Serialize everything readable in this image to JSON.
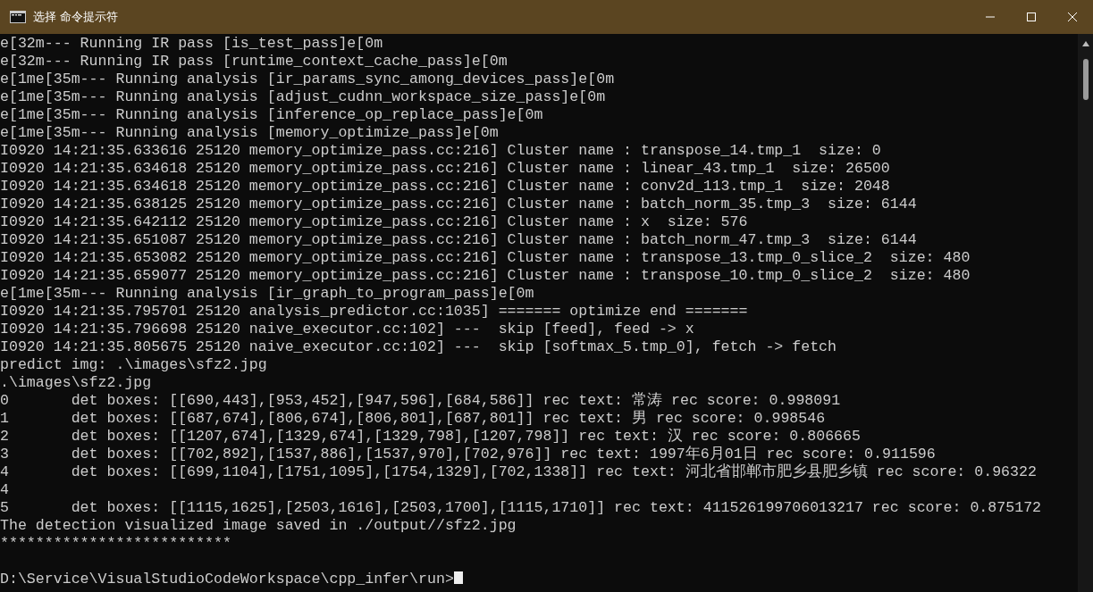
{
  "window": {
    "title": "选择 命令提示符"
  },
  "console": {
    "lines": [
      "e[32m--- Running IR pass [is_test_pass]e[0m",
      "e[32m--- Running IR pass [runtime_context_cache_pass]e[0m",
      "e[1me[35m--- Running analysis [ir_params_sync_among_devices_pass]e[0m",
      "e[1me[35m--- Running analysis [adjust_cudnn_workspace_size_pass]e[0m",
      "e[1me[35m--- Running analysis [inference_op_replace_pass]e[0m",
      "e[1me[35m--- Running analysis [memory_optimize_pass]e[0m",
      "I0920 14:21:35.633616 25120 memory_optimize_pass.cc:216] Cluster name : transpose_14.tmp_1  size: 0",
      "I0920 14:21:35.634618 25120 memory_optimize_pass.cc:216] Cluster name : linear_43.tmp_1  size: 26500",
      "I0920 14:21:35.634618 25120 memory_optimize_pass.cc:216] Cluster name : conv2d_113.tmp_1  size: 2048",
      "I0920 14:21:35.638125 25120 memory_optimize_pass.cc:216] Cluster name : batch_norm_35.tmp_3  size: 6144",
      "I0920 14:21:35.642112 25120 memory_optimize_pass.cc:216] Cluster name : x  size: 576",
      "I0920 14:21:35.651087 25120 memory_optimize_pass.cc:216] Cluster name : batch_norm_47.tmp_3  size: 6144",
      "I0920 14:21:35.653082 25120 memory_optimize_pass.cc:216] Cluster name : transpose_13.tmp_0_slice_2  size: 480",
      "I0920 14:21:35.659077 25120 memory_optimize_pass.cc:216] Cluster name : transpose_10.tmp_0_slice_2  size: 480",
      "e[1me[35m--- Running analysis [ir_graph_to_program_pass]e[0m",
      "I0920 14:21:35.795701 25120 analysis_predictor.cc:1035] ======= optimize end =======",
      "I0920 14:21:35.796698 25120 naive_executor.cc:102] ---  skip [feed], feed -> x",
      "I0920 14:21:35.805675 25120 naive_executor.cc:102] ---  skip [softmax_5.tmp_0], fetch -> fetch",
      "predict img: .\\images\\sfz2.jpg",
      ".\\images\\sfz2.jpg",
      "0       det boxes: [[690,443],[953,452],[947,596],[684,586]] rec text: 常涛 rec score: 0.998091",
      "1       det boxes: [[687,674],[806,674],[806,801],[687,801]] rec text: 男 rec score: 0.998546",
      "2       det boxes: [[1207,674],[1329,674],[1329,798],[1207,798]] rec text: 汉 rec score: 0.806665",
      "3       det boxes: [[702,892],[1537,886],[1537,970],[702,976]] rec text: 1997年6月01日 rec score: 0.911596",
      "4       det boxes: [[699,1104],[1751,1095],[1754,1329],[702,1338]] rec text: 河北省邯郸市肥乡县肥乡镇 rec score: 0.96322",
      "4",
      "5       det boxes: [[1115,1625],[2503,1616],[2503,1700],[1115,1710]] rec text: 411526199706013217 rec score: 0.875172",
      "The detection visualized image saved in ./output//sfz2.jpg",
      "**************************"
    ],
    "prompt": {
      "text": "D:\\Service\\VisualStudioCodeWorkspace\\cpp_infer\\run>",
      "cursor": true
    }
  }
}
